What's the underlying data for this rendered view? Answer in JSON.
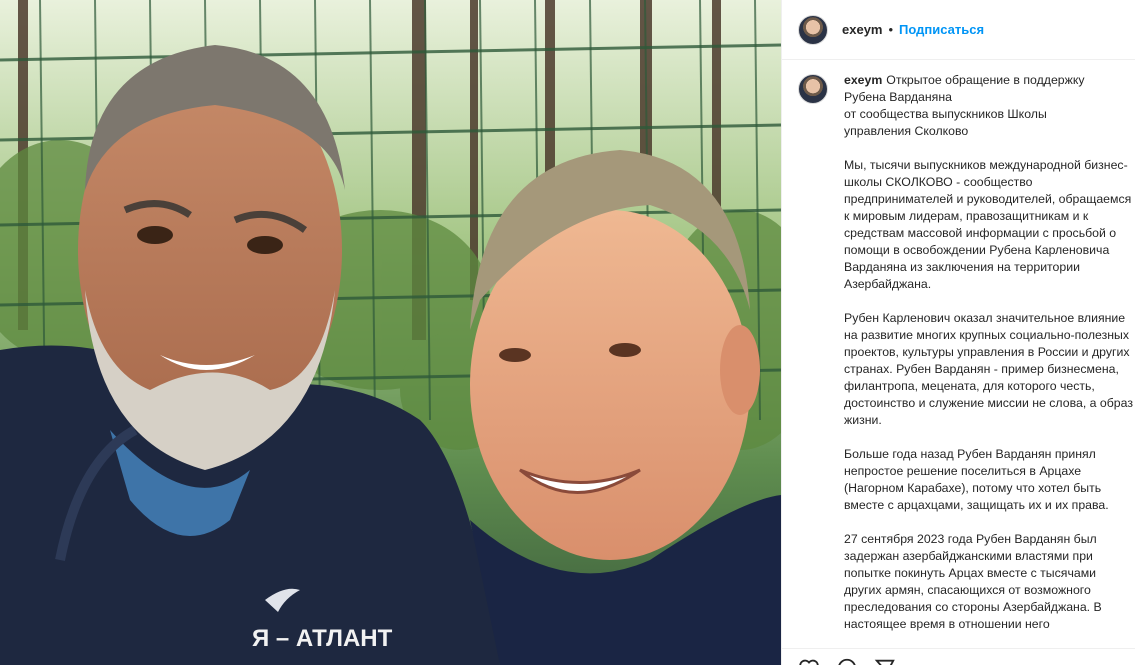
{
  "photo": {
    "badge_text": "Я – АТЛАНТ",
    "icon": "eagle-logo-icon"
  },
  "post": {
    "username": "exeym",
    "separator": "•",
    "follow_label": "Подписаться",
    "caption": {
      "author": "exeym",
      "lines_first": [
        "Открытое обращение в поддержку",
        "Рубена Варданяна",
        "от сообщества выпускников Школы",
        "управления Сколково"
      ],
      "paragraphs": [
        "Мы, тысячи выпускников международной бизнес-школы СКОЛКОВО - сообщество предпринимателей и руководителей, обращаемся к мировым лидерам, правозащитникам и к средствам массовой информации с просьбой о помощи в освобождении Рубена Карленовича Варданяна из заключения на территории Азербайджана.",
        "Рубен Карленович оказал значительное влияние на развитие многих крупных социально-полезных проектов, культуры управления в России и других странах. Рубен Варданян - пример бизнесмена, филантропа, мецената, для которого честь, достоинство и служение миссии не слова, а образ жизни.",
        "Больше года назад Рубен Варданян принял непростое решение поселиться в Арцахе (Нагорном Карабахе), потому что хотел быть вместе с арцахцами, защищать их и их права.",
        "27 сентября 2023 года Рубен Варданян был задержан азербайджанскими властями при попытке покинуть Арцах вместе с тысячами других армян, спасающихся от возможного преследования со стороны Азербайджана. В настоящее время в отношении него"
      ]
    },
    "action_icons": [
      "heart-icon",
      "comment-icon",
      "share-icon"
    ]
  },
  "colors": {
    "follow": "#0095f6",
    "text": "#262626",
    "divider": "#efefef"
  }
}
